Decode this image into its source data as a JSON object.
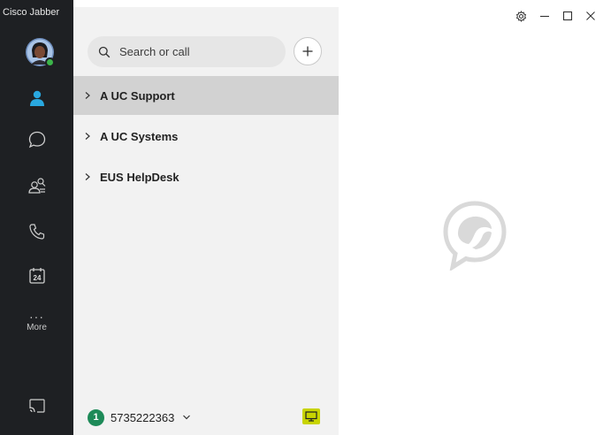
{
  "app": {
    "title": "Cisco Jabber"
  },
  "nav": {
    "items": [
      {
        "id": "contacts",
        "icon": "person-icon",
        "active": true
      },
      {
        "id": "chats",
        "icon": "chat-bubble-icon"
      },
      {
        "id": "meetings",
        "icon": "group-search-icon"
      },
      {
        "id": "calls",
        "icon": "phone-icon"
      },
      {
        "id": "calendar",
        "icon": "calendar-icon",
        "day": "24"
      }
    ],
    "more_dots": "···",
    "more_label": "More"
  },
  "search": {
    "placeholder": "Search or call"
  },
  "groups": [
    {
      "label": "A UC Support",
      "selected": true
    },
    {
      "label": "A UC Systems"
    },
    {
      "label": "EUS HelpDesk"
    }
  ],
  "footer": {
    "badge": "1",
    "number": "5735222363"
  },
  "colors": {
    "rail_bg": "#1e2023",
    "accent": "#29a8e0",
    "status_online": "#3cb54a",
    "badge": "#1d8a58",
    "screen_share": "#c8d400"
  }
}
